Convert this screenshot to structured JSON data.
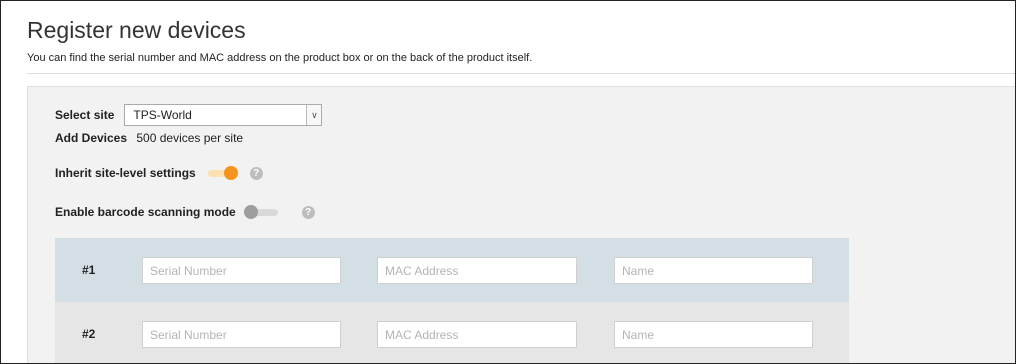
{
  "header": {
    "title": "Register new devices",
    "subtitle": "You can find the serial number and MAC address on the product box or on the back of the product itself."
  },
  "site": {
    "label": "Select site",
    "selected": "TPS-World"
  },
  "add_devices": {
    "label": "Add Devices",
    "limit_text": "500 devices per site"
  },
  "inherit": {
    "label": "Inherit site-level settings",
    "enabled": true
  },
  "barcode": {
    "label": "Enable barcode scanning mode",
    "enabled": false
  },
  "colors": {
    "toggle_on": "#f7941d",
    "toggle_off": "#9e9e9e",
    "row_highlight": "#d4dee5"
  },
  "icons": {
    "help": "?",
    "dropdown": "chevron-down"
  },
  "devices": [
    {
      "number": "#1",
      "serial_placeholder": "Serial Number",
      "mac_placeholder": "MAC Address",
      "name_placeholder": "Name"
    },
    {
      "number": "#2",
      "serial_placeholder": "Serial Number",
      "mac_placeholder": "MAC Address",
      "name_placeholder": "Name"
    }
  ]
}
